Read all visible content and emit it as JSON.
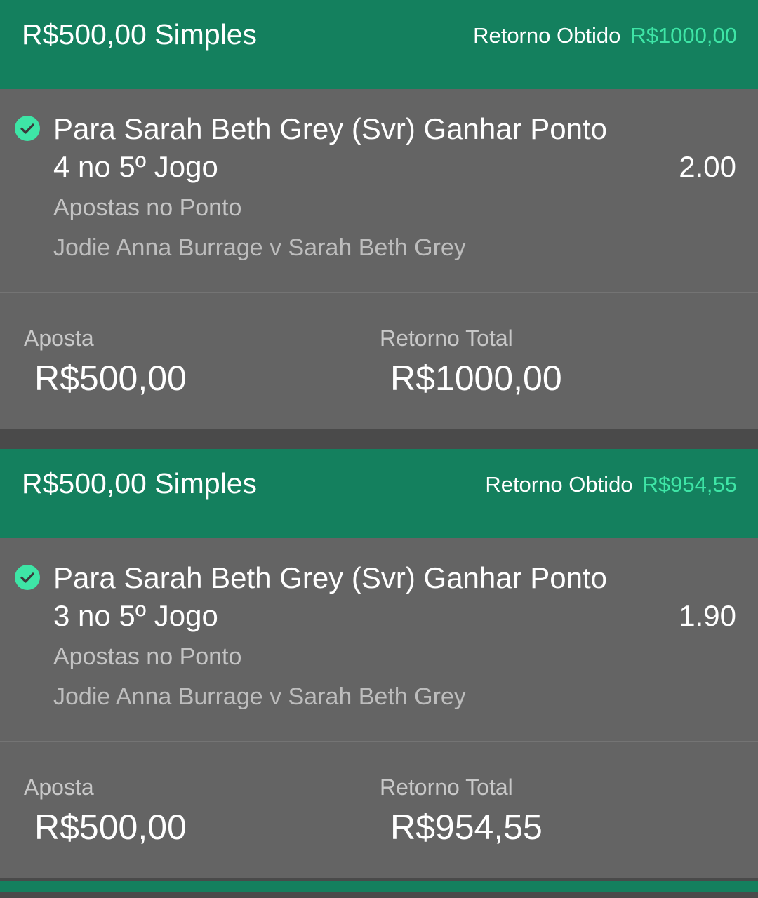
{
  "bets": [
    {
      "title": "R$500,00 Simples",
      "return_label": "Retorno Obtido",
      "return_value": "R$1000,00",
      "selection_line1": "Para Sarah Beth Grey (Svr) Ganhar Ponto",
      "selection_line2": "4 no 5º Jogo",
      "odds": "2.00",
      "market": "Apostas no Ponto",
      "event": "Jodie Anna Burrage v Sarah Beth Grey",
      "stake_label": "Aposta",
      "stake_value": "R$500,00",
      "total_label": "Retorno Total",
      "total_value": "R$1000,00",
      "status_icon": "check-circle-icon"
    },
    {
      "title": "R$500,00 Simples",
      "return_label": "Retorno Obtido",
      "return_value": "R$954,55",
      "selection_line1": "Para Sarah Beth Grey (Svr) Ganhar Ponto",
      "selection_line2": "3 no 5º Jogo",
      "odds": "1.90",
      "market": "Apostas no Ponto",
      "event": "Jodie Anna Burrage v Sarah Beth Grey",
      "stake_label": "Aposta",
      "stake_value": "R$500,00",
      "total_label": "Retorno Total",
      "total_value": "R$954,55",
      "status_icon": "check-circle-icon"
    }
  ],
  "colors": {
    "header_green": "#14805e",
    "return_value_green": "#3ee5a6",
    "panel_gray": "#646464"
  }
}
